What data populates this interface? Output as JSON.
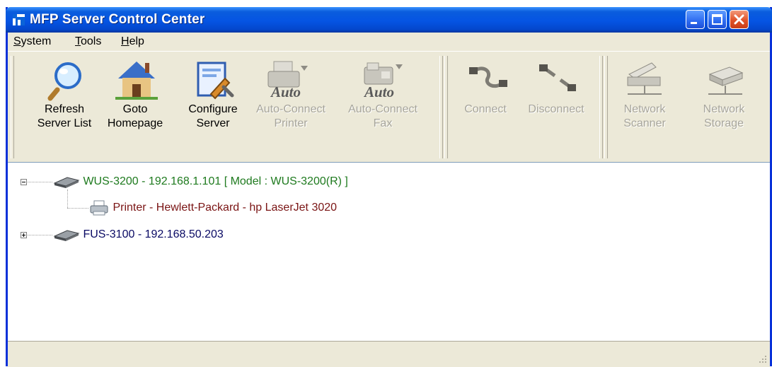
{
  "window": {
    "title": "MFP Server Control Center"
  },
  "menu": [
    {
      "mnemonic": "S",
      "rest": "ystem"
    },
    {
      "mnemonic": "T",
      "rest": "ools"
    },
    {
      "mnemonic": "H",
      "rest": "elp"
    }
  ],
  "toolbar": {
    "refresh": "Refresh\nServer List",
    "goto": "Goto\nHomepage",
    "configure": "Configure\nServer",
    "auto_printer": "Auto-Connect\nPrinter",
    "auto_fax": "Auto-Connect\nFax",
    "connect": "Connect",
    "disconnect": "Disconnect",
    "scanner": "Network\nScanner",
    "storage": "Network\nStorage",
    "auto_badge": "Auto"
  },
  "tree": {
    "server1": "WUS-3200 - 192.168.1.101 [ Model : WUS-3200(R) ]",
    "printer1": "Printer - Hewlett-Packard - hp LaserJet 3020",
    "server2": "FUS-3100 - 192.168.50.203"
  },
  "colors": {
    "server_connected": "#1e7a1e",
    "printer": "#7a1414",
    "server_default": "#0a0a64"
  }
}
